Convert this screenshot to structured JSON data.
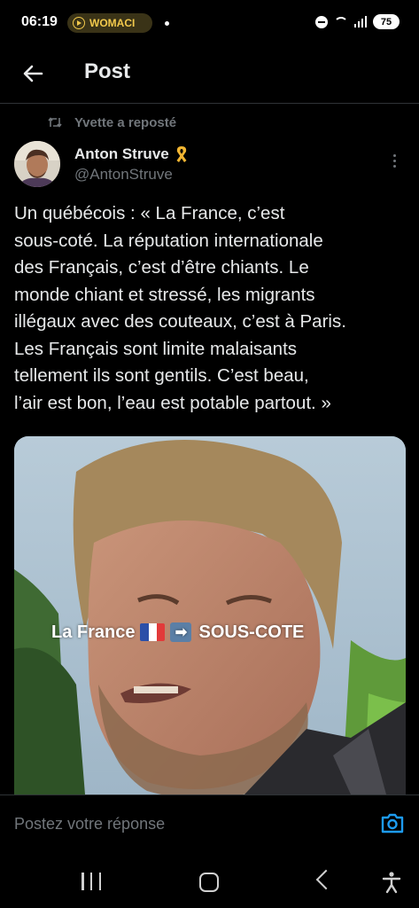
{
  "status_bar": {
    "time": "06:19",
    "media_pill": "WOMACI",
    "battery": "75",
    "icons": [
      "play-icon",
      "dnd-icon",
      "wifi-icon",
      "signal-icon",
      "battery-icon"
    ]
  },
  "header": {
    "title": "Post",
    "back_icon": "arrow-left-icon"
  },
  "repost": {
    "label": "Yvette a reposté",
    "icon": "repost-icon"
  },
  "post": {
    "author_name": "Anton Struve",
    "author_badge_icon": "yellow-ribbon-icon",
    "author_handle": "@AntonStruve",
    "text": "Un québécois : « La France, c’est\nsous-coté. La réputation internationale\ndes Français, c’est d’être chiants. Le\nmonde chiant et stressé, les migrants\nillégaux avec des couteaux, c’est à Paris.\nLes Français sont limite malaisants\ntellement ils sont gentils. C’est beau,\nl’air est bon, l’eau est potable partout. »",
    "media_caption_left": "La France",
    "media_caption_right": "SOUS-COTE",
    "media_caption_arrow": "➡"
  },
  "reply": {
    "placeholder": "Postez votre réponse",
    "camera_icon": "camera-icon"
  },
  "nav": {
    "icons": [
      "recents-icon",
      "home-icon",
      "back-icon",
      "accessibility-icon"
    ]
  },
  "colors": {
    "background": "#000000",
    "text": "#e7e9ea",
    "muted": "#71767b",
    "accent": "#1d9bf0",
    "divider": "#2f3336"
  }
}
